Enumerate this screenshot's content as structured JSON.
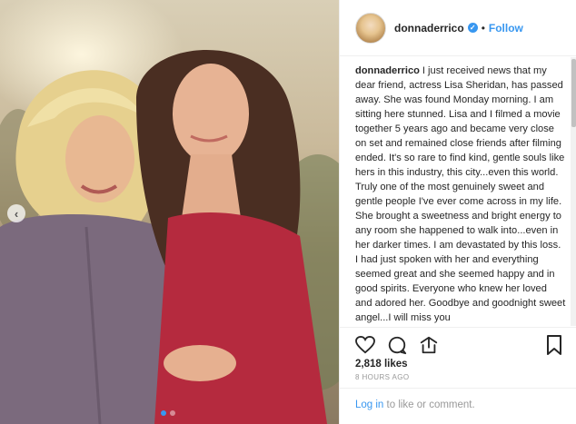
{
  "post": {
    "username": "donnaderrico",
    "separator": "•",
    "follow_label": "Follow",
    "verified_glyph": "✓",
    "caption_author": "donnaderrico",
    "caption_text": "I just received news that my dear friend, actress Lisa Sheridan, has passed away. She was found Monday morning. I am sitting here stunned. Lisa and I filmed a movie together 5 years ago and became very close on set and remained close friends after filming ended. It's so rare to find kind, gentle souls like hers in this industry, this city...even this world. Truly one of the most genuinely sweet and gentle people I've ever come across in my life. She brought a sweetness and bright energy to any room she happened to walk into...even in her darker times. I am devastated by this loss. I had just spoken with her and everything seemed great and she seemed happy and in good spirits. Everyone who knew her loved and adored her. Goodbye and goodnight sweet angel...I will miss you",
    "likes": "2,818 likes",
    "time": "8 HOURS AGO",
    "comment_login": "Log in",
    "comment_rest": " to like or comment."
  },
  "carousel": {
    "prev_glyph": "‹",
    "slide_count": 2,
    "active_slide": 1
  },
  "icons": [
    "heart-icon",
    "comment-icon",
    "share-icon",
    "bookmark-icon",
    "verified-badge-icon"
  ],
  "colors": {
    "accent": "#3897f0",
    "text": "#262626",
    "muted": "#999999",
    "border": "#efefef"
  }
}
